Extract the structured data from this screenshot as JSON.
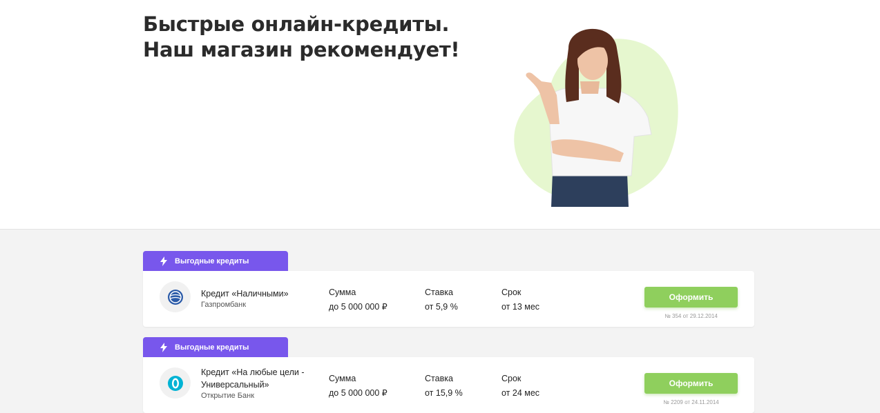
{
  "hero": {
    "title_line1": "Быстрые онлайн-кредиты.",
    "title_line2": "Наш магазин рекомендует!"
  },
  "colors": {
    "accent": "#7857ec",
    "button": "#8fcf5d",
    "blob": "#e6f7cf"
  },
  "offers": [
    {
      "tab_label": "Выгодные кредиты",
      "tab_icon": "lightning-icon",
      "logo_icon": "gazprombank-logo-icon",
      "name": "Кредит «Наличными»",
      "name_line2": "",
      "bank": "Газпромбанк",
      "sum_label": "Сумма",
      "sum_value": "до 5 000 000 ₽",
      "rate_label": "Ставка",
      "rate_value": "от 5,9 %",
      "term_label": "Срок",
      "term_value": "от 13 мес",
      "button_label": "Оформить",
      "license": "№ 354 от 29.12.2014"
    },
    {
      "tab_label": "Выгодные кредиты",
      "tab_icon": "lightning-icon",
      "logo_icon": "otkritie-logo-icon",
      "name": "Кредит «На любые цели -",
      "name_line2": "Универсальный»",
      "bank": "Открытие Банк",
      "sum_label": "Сумма",
      "sum_value": "до 5 000 000 ₽",
      "rate_label": "Ставка",
      "rate_value": "от 15,9 %",
      "term_label": "Срок",
      "term_value": "от 24 мес",
      "button_label": "Оформить",
      "license": "№ 2209 от 24.11.2014"
    }
  ]
}
